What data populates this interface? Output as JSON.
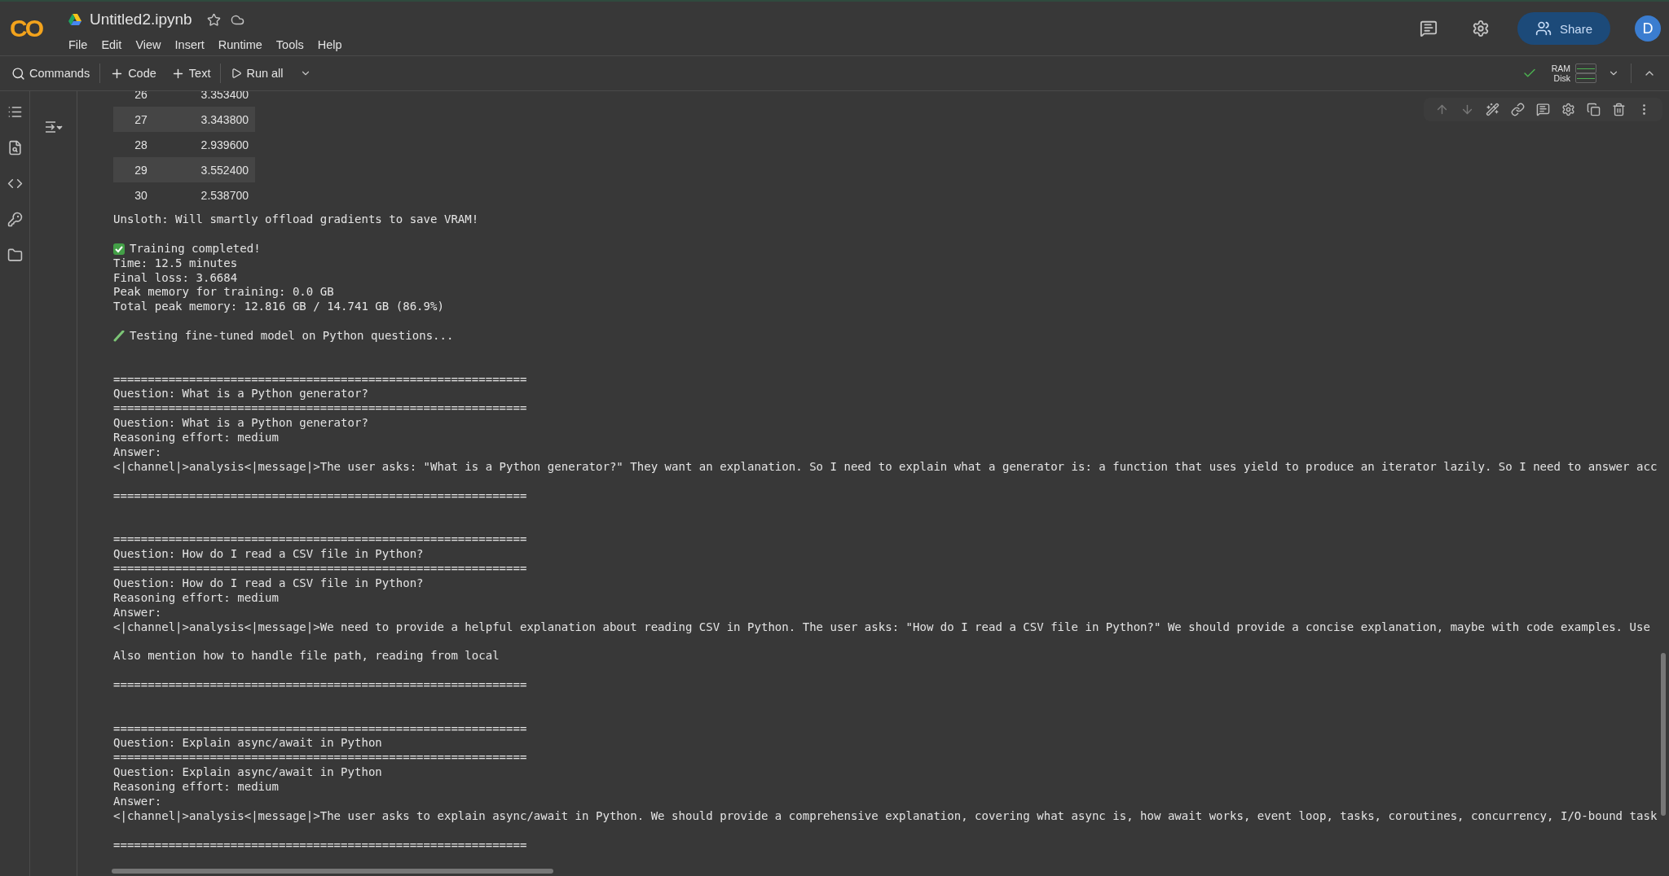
{
  "header": {
    "logo": "CO",
    "title": "Untitled2.ipynb",
    "menu": [
      "File",
      "Edit",
      "View",
      "Insert",
      "Runtime",
      "Tools",
      "Help"
    ],
    "share_label": "Share",
    "avatar_initial": "D"
  },
  "toolbar": {
    "commands": "Commands",
    "add_code": "Code",
    "add_text": "Text",
    "run_all": "Run all",
    "resources": [
      "RAM",
      "Disk"
    ]
  },
  "output": {
    "table_rows": [
      {
        "step": "26",
        "loss": "3.353400"
      },
      {
        "step": "27",
        "loss": "3.343800"
      },
      {
        "step": "28",
        "loss": "2.939600"
      },
      {
        "step": "29",
        "loss": "3.552400"
      },
      {
        "step": "30",
        "loss": "2.538700"
      }
    ],
    "notice": "Unsloth: Will smartly offload gradients to save VRAM!",
    "completed": "Training completed!",
    "summary": [
      "Time: 12.5 minutes",
      "Final loss: 3.6684",
      "Peak memory for training: 0.0 GB",
      "Total peak memory: 12.816 GB / 14.741 GB (86.9%)"
    ],
    "testing": "Testing fine-tuned model on Python questions...",
    "qa": [
      {
        "rule_top": "============================================================",
        "question": "Question: What is a Python generator?",
        "rule_mid": "============================================================",
        "question_repeat": "Question: What is a Python generator?",
        "reasoning": "Reasoning effort: medium",
        "answer_label": "Answer:",
        "answer": [
          "<|channel|>analysis<|message|>The user asks: \"What is a Python generator?\" They want an explanation. So I need to explain what a generator is: a function that uses yield to produce an iterator lazily. So I need to answer acc"
        ],
        "rule_bottom": "============================================================"
      },
      {
        "rule_top": "============================================================",
        "question": "Question: How do I read a CSV file in Python?",
        "rule_mid": "============================================================",
        "question_repeat": "Question: How do I read a CSV file in Python?",
        "reasoning": "Reasoning effort: medium",
        "answer_label": "Answer:",
        "answer": [
          "<|channel|>analysis<|message|>We need to provide a helpful explanation about reading CSV in Python. The user asks: \"How do I read a CSV file in Python?\" We should provide a concise explanation, maybe with code examples. Use",
          "Also mention how to handle file path, reading from local"
        ],
        "rule_bottom": "============================================================"
      },
      {
        "rule_top": "============================================================",
        "question": "Question: Explain async/await in Python",
        "rule_mid": "============================================================",
        "question_repeat": "Question: Explain async/await in Python",
        "reasoning": "Reasoning effort: medium",
        "answer_label": "Answer:",
        "answer": [
          "<|channel|>analysis<|message|>The user asks to explain async/await in Python. We should provide a comprehensive explanation, covering what async is, how await works, event loop, tasks, coroutines, concurrency, I/O-bound task"
        ],
        "rule_bottom": "============================================================"
      }
    ]
  }
}
